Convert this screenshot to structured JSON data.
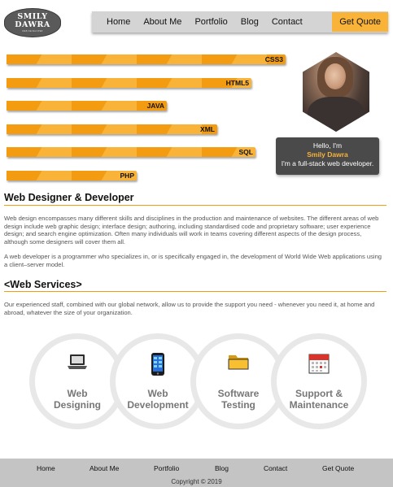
{
  "logo": {
    "line1": "SMILY",
    "line2": "DAWRA",
    "tagline": "WEB DEVELOPER"
  },
  "nav": {
    "items": [
      "Home",
      "About Me",
      "Portfolio",
      "Blog",
      "Contact"
    ],
    "cta": "Get Quote"
  },
  "skills": [
    {
      "label": "CSS3",
      "level": 0.73
    },
    {
      "label": "HTML5",
      "level": 0.64
    },
    {
      "label": "JAVA",
      "level": 0.42
    },
    {
      "label": "XML",
      "level": 0.55
    },
    {
      "label": "SQL",
      "level": 0.65
    },
    {
      "label": "PHP",
      "level": 0.34
    }
  ],
  "intro": {
    "greeting": "Hello, I'm",
    "name": "Smily Dawra",
    "role": "I'm a full-stack web developer."
  },
  "section1": {
    "heading": "Web Designer & Developer",
    "p1": "Web design encompasses many different skills and disciplines in the production and maintenance of websites. The different areas of web design include web graphic design; interface design; authoring, including standardised code and proprietary software; user experience design; and search engine optimization. Often many individuals will work in teams covering different aspects of the design process, although some designers will cover them all.",
    "p2": "A web developer is a programmer who specializes in, or is specifically engaged in, the development of World Wide Web applications using a client–server model."
  },
  "section2": {
    "heading": "<Web Services>",
    "p1": "Our experienced staff, combined with our global network, allow us to provide the support you need - whenever you need it, at home and abroad, whatever the size of your organization."
  },
  "services": [
    {
      "line1": "Web",
      "line2": "Designing",
      "icon": "laptop-icon"
    },
    {
      "line1": "Web",
      "line2": "Development",
      "icon": "phone-icon"
    },
    {
      "line1": "Software",
      "line2": "Testing",
      "icon": "folder-icon"
    },
    {
      "line1": "Support &",
      "line2": "Maintenance",
      "icon": "calendar-icon"
    }
  ],
  "footer": {
    "items": [
      "Home",
      "About Me",
      "Portfolio",
      "Blog",
      "Contact",
      "Get Quote"
    ],
    "copyright": "Copyright © 2019"
  },
  "colors": {
    "accent": "#f8b338",
    "accent_dark": "#f39c12",
    "nav_bg": "#d4d4d4",
    "footer_bg": "#c4c4c4",
    "intro_bg": "#4a4a4a"
  }
}
